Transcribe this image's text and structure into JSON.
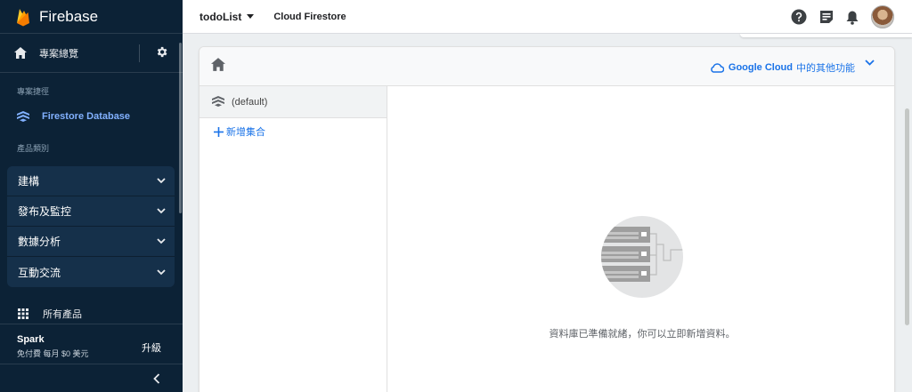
{
  "app": {
    "title": "Firebase"
  },
  "sidebar": {
    "overview_label": "專案總覽",
    "shortcuts_label": "專案捷徑",
    "shortcut_item": "Firestore Database",
    "categories_label": "產品類別",
    "categories": [
      {
        "label": "建構"
      },
      {
        "label": "發布及監控"
      },
      {
        "label": "數據分析"
      },
      {
        "label": "互動交流"
      }
    ],
    "all_products_label": "所有產品",
    "plan": {
      "name": "Spark",
      "desc": "免付費 每月 $0 美元",
      "upgrade_label": "升級"
    }
  },
  "topbar": {
    "project": "todoList",
    "product": "Cloud Firestore"
  },
  "card": {
    "google_cloud_strong": "Google Cloud",
    "google_cloud_rest": "中的其他功能",
    "database_label": "(default)",
    "add_collection_label": "新增集合",
    "empty_message": "資料庫已準備就緒，你可以立即新增資料。"
  },
  "colors": {
    "sidebar_bg": "#0c2236",
    "accent": "#1a73e8",
    "highlight": "#82b1ff",
    "flame": "#ffa000"
  },
  "icons": [
    "firebase-flame-icon",
    "home-icon",
    "gear-icon",
    "firestore-icon",
    "chevron-down-icon",
    "grid-icon",
    "chevron-left-icon",
    "caret-down-icon",
    "help-icon",
    "release-notes-icon",
    "bell-icon",
    "cloud-icon",
    "plus-icon",
    "empty-database-illustration"
  ]
}
